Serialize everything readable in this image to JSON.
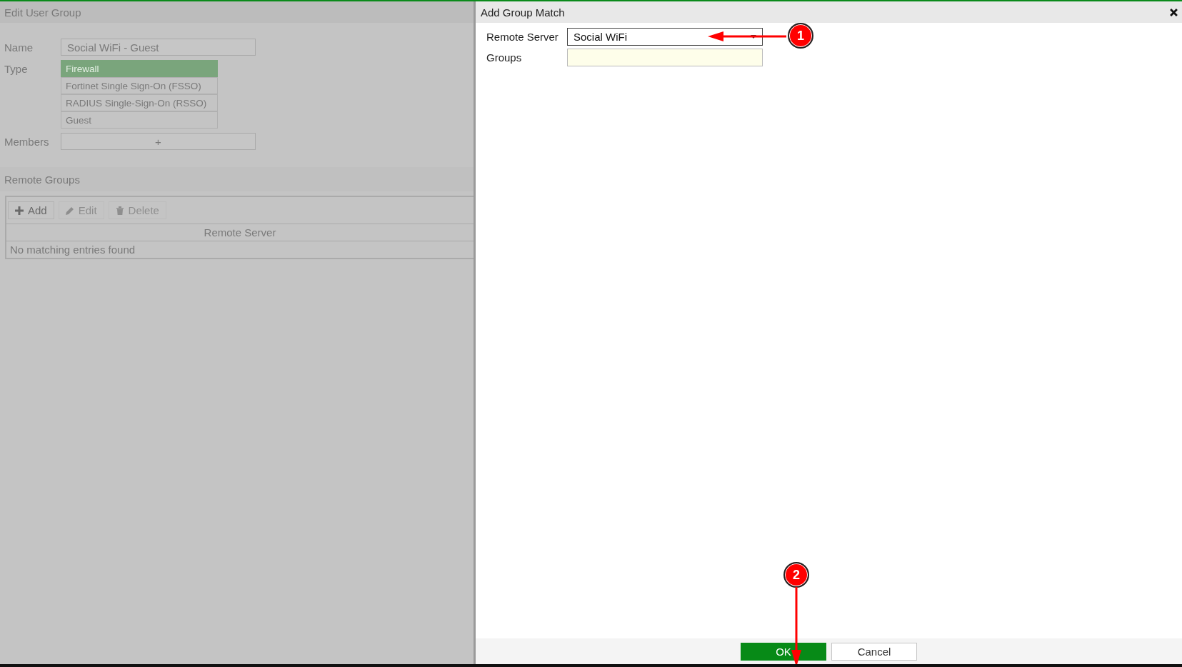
{
  "edit_user_group": {
    "title": "Edit User Group",
    "name_label": "Name",
    "name_value": "Social WiFi - Guest",
    "type_label": "Type",
    "type_options": [
      {
        "label": "Firewall",
        "selected": true
      },
      {
        "label": "Fortinet Single Sign-On (FSSO)",
        "selected": false
      },
      {
        "label": "RADIUS Single-Sign-On (RSSO)",
        "selected": false
      },
      {
        "label": "Guest",
        "selected": false
      }
    ],
    "members_label": "Members",
    "members_add": "+",
    "remote_groups": {
      "title": "Remote Groups",
      "toolbar": [
        {
          "label": "Add",
          "kind": "add",
          "disabled": false
        },
        {
          "label": "Edit",
          "kind": "edit",
          "disabled": true
        },
        {
          "label": "Delete",
          "kind": "delete",
          "disabled": true
        }
      ],
      "columns": [
        "Remote Server"
      ],
      "empty": "No matching entries found"
    }
  },
  "dialog": {
    "title": "Add Group Match",
    "fields": [
      {
        "label": "Remote Server",
        "kind": "select",
        "value": "Social WiFi"
      },
      {
        "label": "Groups",
        "kind": "text"
      }
    ],
    "buttons": [
      {
        "label": "OK",
        "kind": "primary"
      },
      {
        "label": "Cancel",
        "kind": "secondary"
      }
    ]
  },
  "annotations": [
    {
      "label": "1"
    },
    {
      "label": "2"
    }
  ]
}
